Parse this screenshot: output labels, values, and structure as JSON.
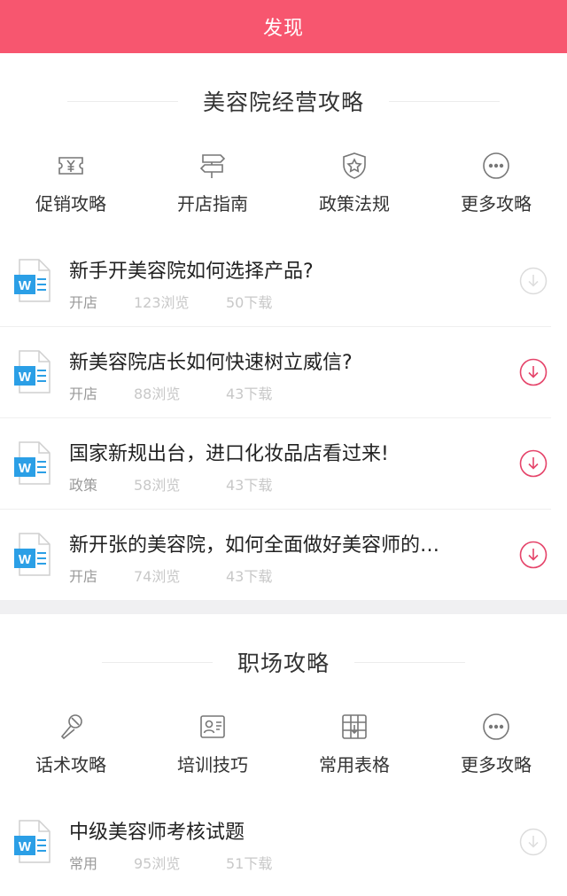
{
  "header": {
    "title": "发现"
  },
  "section1": {
    "title": "美容院经营攻略",
    "categories": [
      {
        "label": "促销攻略",
        "icon": "coupon-yen-icon"
      },
      {
        "label": "开店指南",
        "icon": "signpost-icon"
      },
      {
        "label": "政策法规",
        "icon": "shield-star-icon"
      },
      {
        "label": "更多攻略",
        "icon": "more-dots-icon"
      }
    ],
    "docs": [
      {
        "title": "新手开美容院如何选择产品?",
        "tag": "开店",
        "views": "123浏览",
        "downloads": "50下载",
        "download_state": "disabled"
      },
      {
        "title": "新美容院店长如何快速树立威信?",
        "tag": "开店",
        "views": "88浏览",
        "downloads": "43下载",
        "download_state": "active"
      },
      {
        "title": "国家新规出台，进口化妆品店看过来!",
        "tag": "政策",
        "views": "58浏览",
        "downloads": "43下载",
        "download_state": "active"
      },
      {
        "title": "新开张的美容院，如何全面做好美容师的…",
        "tag": "开店",
        "views": "74浏览",
        "downloads": "43下载",
        "download_state": "active"
      }
    ]
  },
  "section2": {
    "title": "职场攻略",
    "categories": [
      {
        "label": "话术攻略",
        "icon": "microphone-icon"
      },
      {
        "label": "培训技巧",
        "icon": "id-card-icon"
      },
      {
        "label": "常用表格",
        "icon": "table-grid-icon"
      },
      {
        "label": "更多攻略",
        "icon": "more-dots-icon"
      }
    ],
    "docs": [
      {
        "title": "中级美容师考核试题",
        "tag": "常用",
        "views": "95浏览",
        "downloads": "51下载",
        "download_state": "disabled"
      }
    ]
  },
  "colors": {
    "header_bg": "#f7566f",
    "accent": "#e5446a",
    "disabled": "#dcdcdc",
    "word_blue": "#2b9fe6"
  }
}
